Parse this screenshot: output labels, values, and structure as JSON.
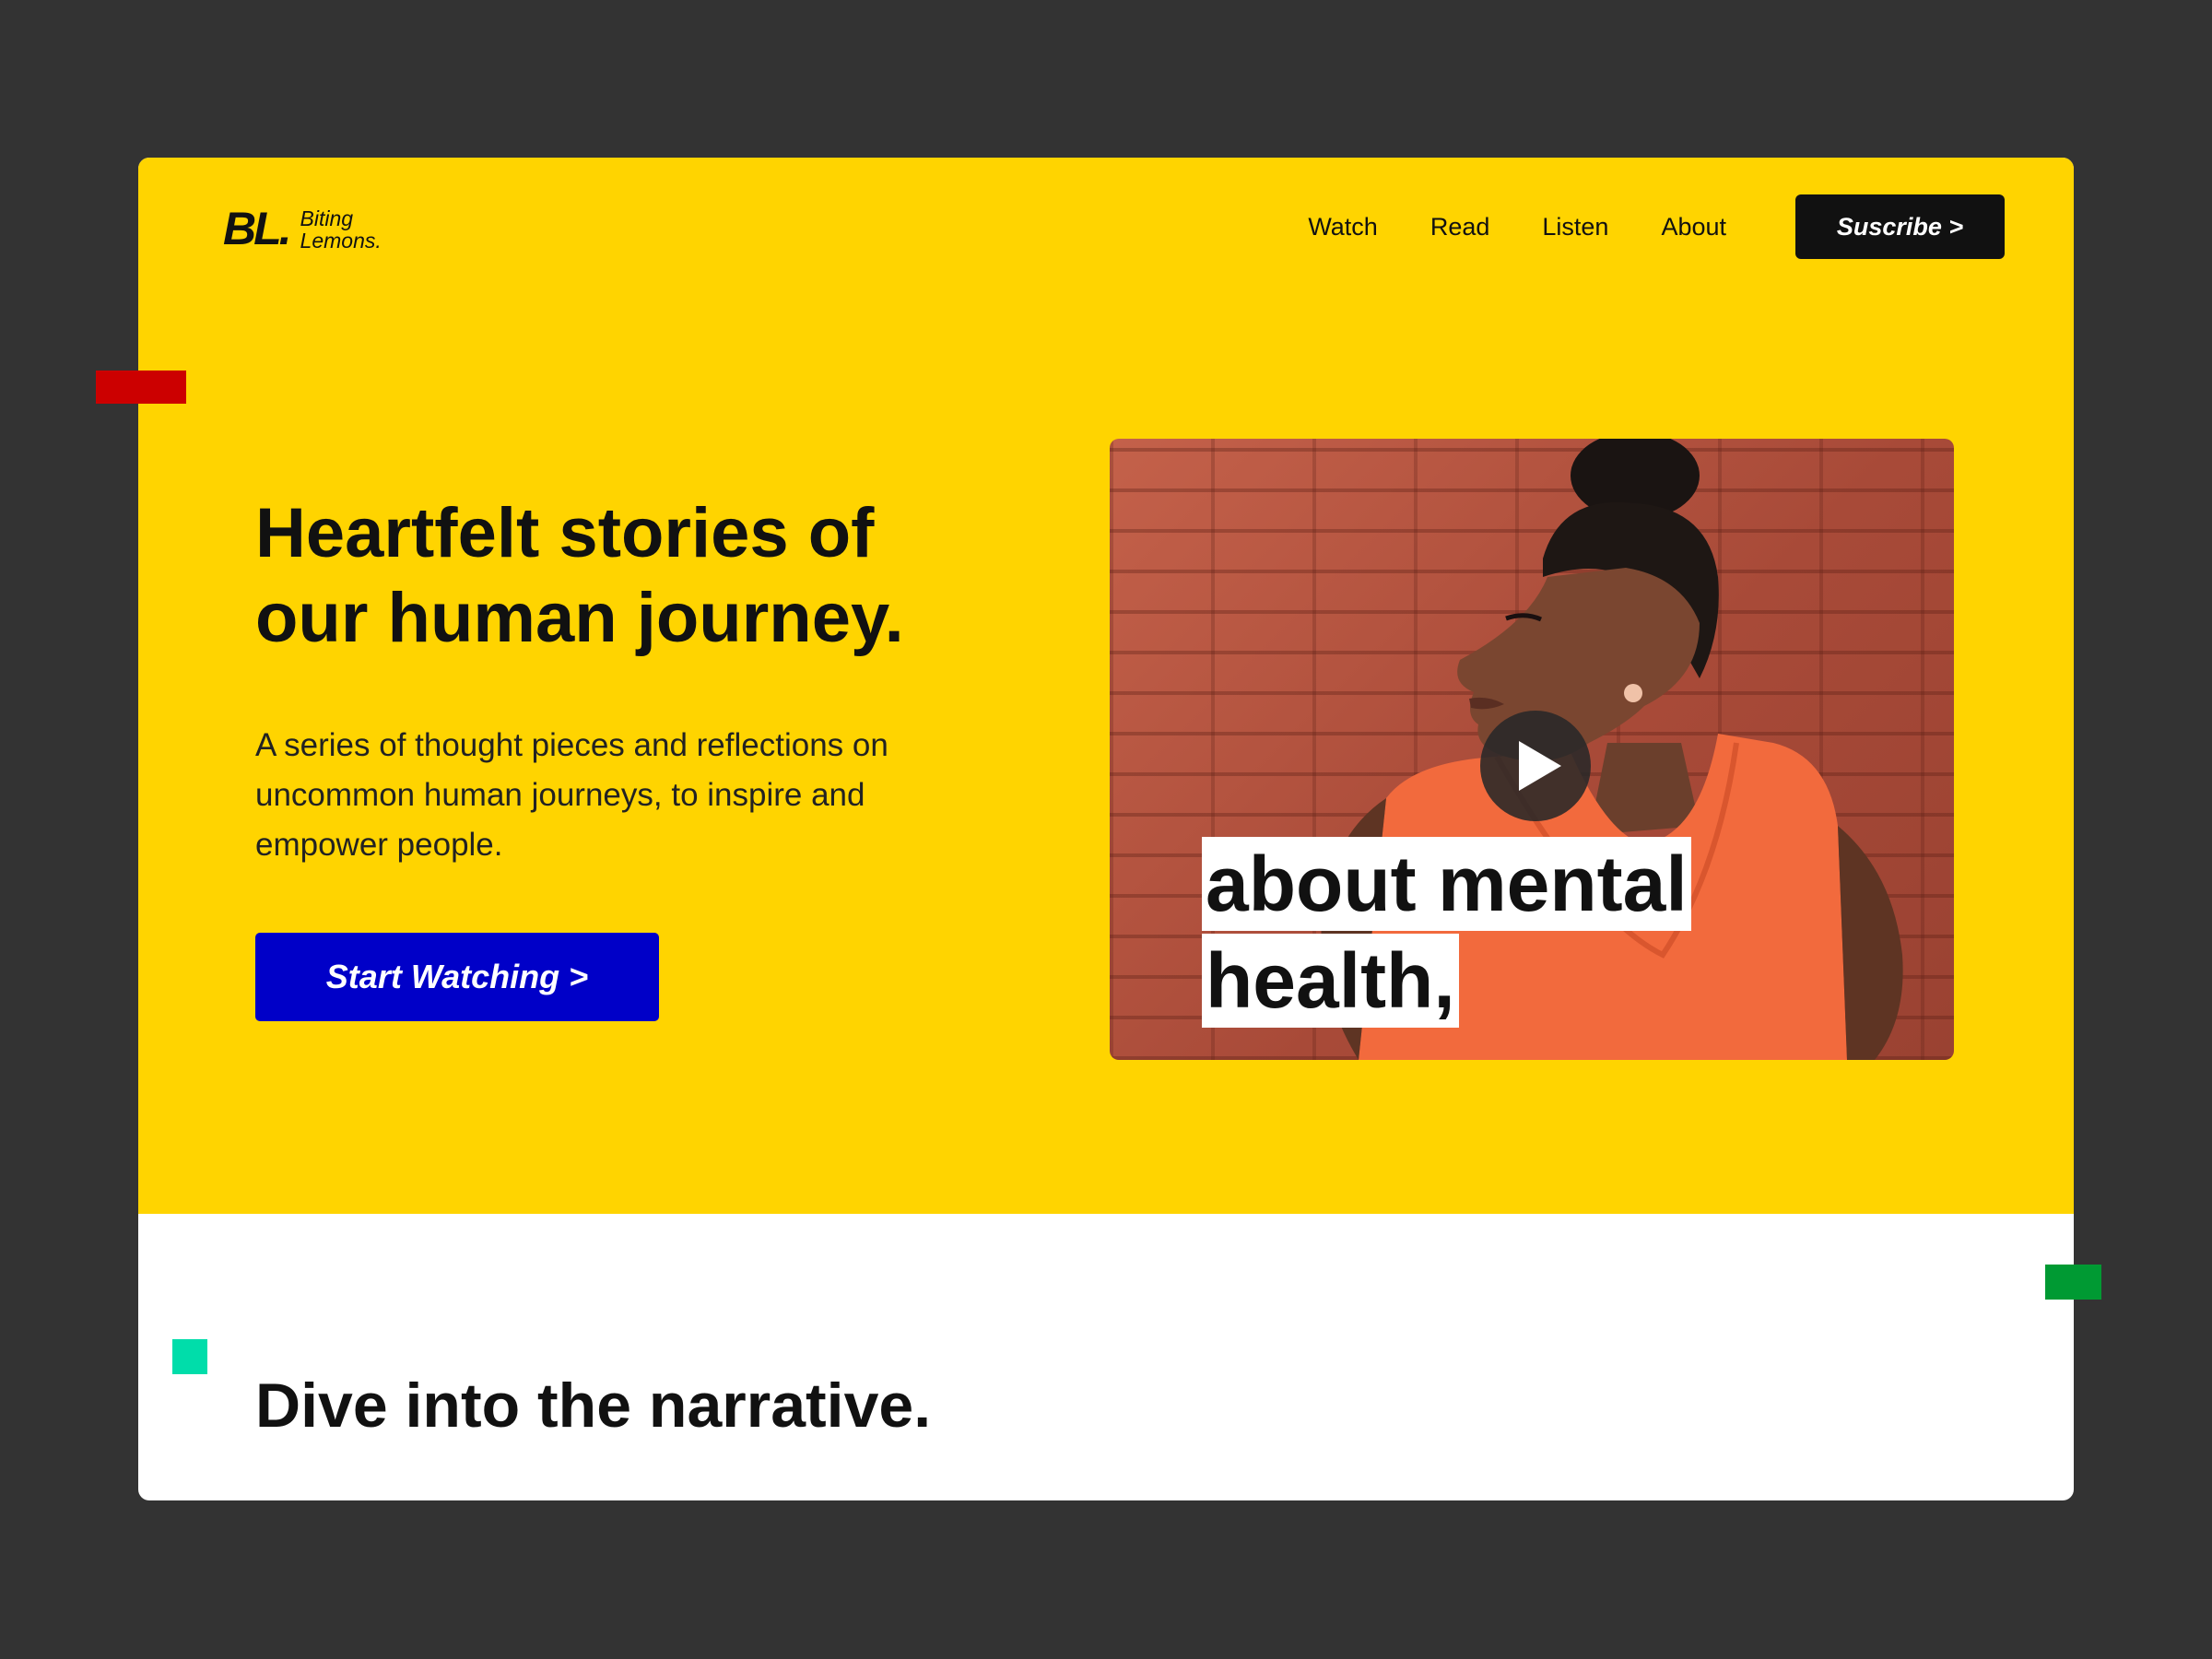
{
  "logo": {
    "mark": "BL.",
    "line1": "Biting",
    "line2": "Lemons."
  },
  "nav": {
    "items": [
      {
        "label": "Watch"
      },
      {
        "label": "Read"
      },
      {
        "label": "Listen"
      },
      {
        "label": "About"
      }
    ],
    "subscribe_label": "Suscribe >"
  },
  "hero": {
    "title_line1": "Heartfelt stories of",
    "title_line2": "our human journey.",
    "description": "A series of thought pieces and reflections on uncommon human journeys, to inspire and empower people.",
    "cta_label": "Start Watching >"
  },
  "video": {
    "caption_line1": "about mental",
    "caption_line2": "health,",
    "play_icon": "play-icon"
  },
  "section": {
    "title": "Dive into the narrative."
  },
  "colors": {
    "background": "#333333",
    "hero_yellow": "#FFD400",
    "cta_blue": "#0000C8",
    "dark": "#111111",
    "accent_red": "#CC0000",
    "accent_green": "#009A33",
    "accent_teal": "#00DDAA"
  }
}
